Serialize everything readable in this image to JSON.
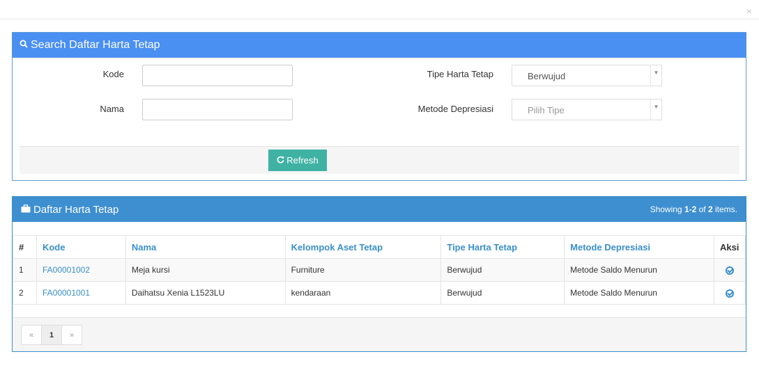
{
  "modal": {
    "close_glyph": "×"
  },
  "search_panel": {
    "title": "Search Daftar Harta Tetap",
    "icon": "search-icon",
    "fields": {
      "kode_label": "Kode",
      "kode_value": "",
      "nama_label": "Nama",
      "nama_value": "",
      "tipe_label": "Tipe Harta Tetap",
      "tipe_value": "Berwujud",
      "metode_label": "Metode Depresiasi",
      "metode_placeholder": "Pilih Tipe"
    },
    "refresh_label": "Refresh"
  },
  "list_panel": {
    "title": "Daftar Harta Tetap",
    "icon": "briefcase-icon",
    "summary_prefix": "Showing ",
    "summary_range": "1-2",
    "summary_of": " of ",
    "summary_total": "2",
    "summary_suffix": " items.",
    "columns": [
      "#",
      "Kode",
      "Nama",
      "Kelompok Aset Tetap",
      "Tipe Harta Tetap",
      "Metode Depresiasi",
      "Aksi"
    ],
    "rows": [
      {
        "no": "1",
        "kode": "FA00001002",
        "nama": "Meja kursi",
        "kelompok": "Furniture",
        "tipe": "Berwujud",
        "metode": "Metode Saldo Menurun"
      },
      {
        "no": "2",
        "kode": "FA00001001",
        "nama": "Daihatsu Xenia L1523LU",
        "kelompok": "kendaraan",
        "tipe": "Berwujud",
        "metode": "Metode Saldo Menurun"
      }
    ],
    "pagination": {
      "prev": "«",
      "page": "1",
      "next": "»"
    }
  },
  "colors": {
    "search_header": "#4a8ff2",
    "list_header": "#3e8fd0",
    "refresh_button": "#3fb2a4",
    "link": "#3a8fc9"
  }
}
